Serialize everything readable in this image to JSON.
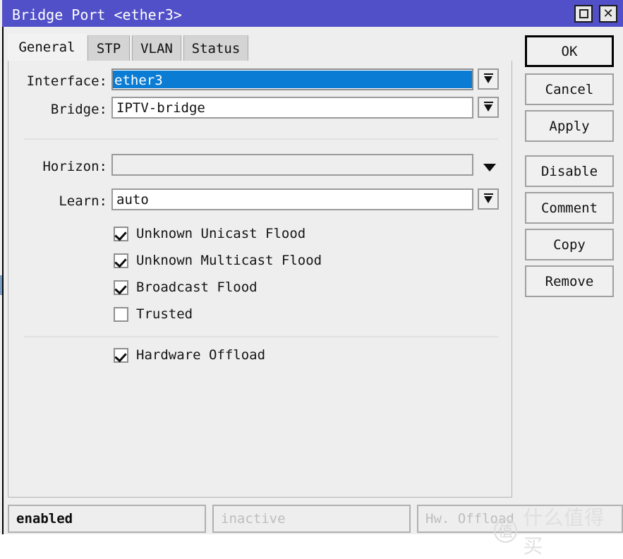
{
  "window": {
    "title": "Bridge Port <ether3>",
    "controls": [
      {
        "name": "maximize-button",
        "icon": "maximize-icon"
      },
      {
        "name": "close-button",
        "icon": "close-icon"
      }
    ]
  },
  "tabs": [
    {
      "label": "General",
      "active": true
    },
    {
      "label": "STP",
      "active": false
    },
    {
      "label": "VLAN",
      "active": false
    },
    {
      "label": "Status",
      "active": false
    }
  ],
  "form": {
    "interface": {
      "label": "Interface:",
      "value": "ether3",
      "selected": true,
      "dropdown_icon": "dropdown-arrow-icon"
    },
    "bridge": {
      "label": "Bridge:",
      "value": "IPTV-bridge",
      "dropdown_icon": "dropdown-arrow-icon"
    },
    "horizon": {
      "label": "Horizon:",
      "value": "",
      "placeholder": "",
      "dropdown_icon": "chevron-down-icon"
    },
    "learn": {
      "label": "Learn:",
      "value": "auto",
      "dropdown_icon": "dropdown-arrow-icon"
    }
  },
  "checkboxes": [
    {
      "label": "Unknown Unicast Flood",
      "checked": true
    },
    {
      "label": "Unknown Multicast Flood",
      "checked": true
    },
    {
      "label": "Broadcast Flood",
      "checked": true
    },
    {
      "label": "Trusted",
      "checked": false
    }
  ],
  "checkboxes2": [
    {
      "label": "Hardware Offload",
      "checked": true
    }
  ],
  "buttons": [
    {
      "label": "OK",
      "default": true
    },
    {
      "label": "Cancel",
      "default": false
    },
    {
      "label": "Apply",
      "default": false
    },
    {
      "label": "Disable",
      "default": false
    },
    {
      "label": "Comment",
      "default": false
    },
    {
      "label": "Copy",
      "default": false
    },
    {
      "label": "Remove",
      "default": false
    }
  ],
  "statusbar": [
    {
      "text": "enabled",
      "state": "strong"
    },
    {
      "text": "inactive",
      "state": "dim"
    },
    {
      "text": "Hw. Offload",
      "state": "dim"
    }
  ],
  "watermark": {
    "mark": "值",
    "text": "什么值得买"
  },
  "colors": {
    "titlebar": "#5250c8",
    "selection": "#0b7cd4",
    "panel": "#eeeeee",
    "tab_inactive": "#d4d4d4"
  }
}
